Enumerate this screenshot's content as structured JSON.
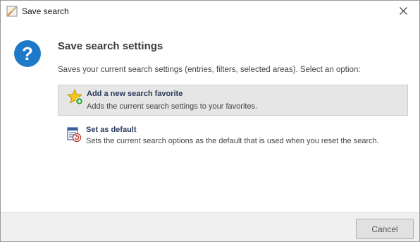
{
  "window": {
    "title": "Save search",
    "app_icon": "document-icon",
    "close_icon": "close-icon"
  },
  "dialog": {
    "icon": "question-icon",
    "heading": "Save search settings",
    "description": "Saves your current search settings (entries, filters, selected areas). Select an option:"
  },
  "options": [
    {
      "icon": "star-add-icon",
      "title": "Add a new search favorite",
      "subtitle": "Adds the current search settings to your favorites.",
      "selected": true
    },
    {
      "icon": "set-default-icon",
      "title": "Set as default",
      "subtitle": "Sets the current search options as the default that is used when you reset the search.",
      "selected": false
    }
  ],
  "footer": {
    "cancel_label": "Cancel"
  },
  "colors": {
    "accent_blue": "#1e7ac8",
    "star_yellow": "#f5c518",
    "add_green": "#3aa541",
    "selected_bg": "#e6e6e6"
  }
}
